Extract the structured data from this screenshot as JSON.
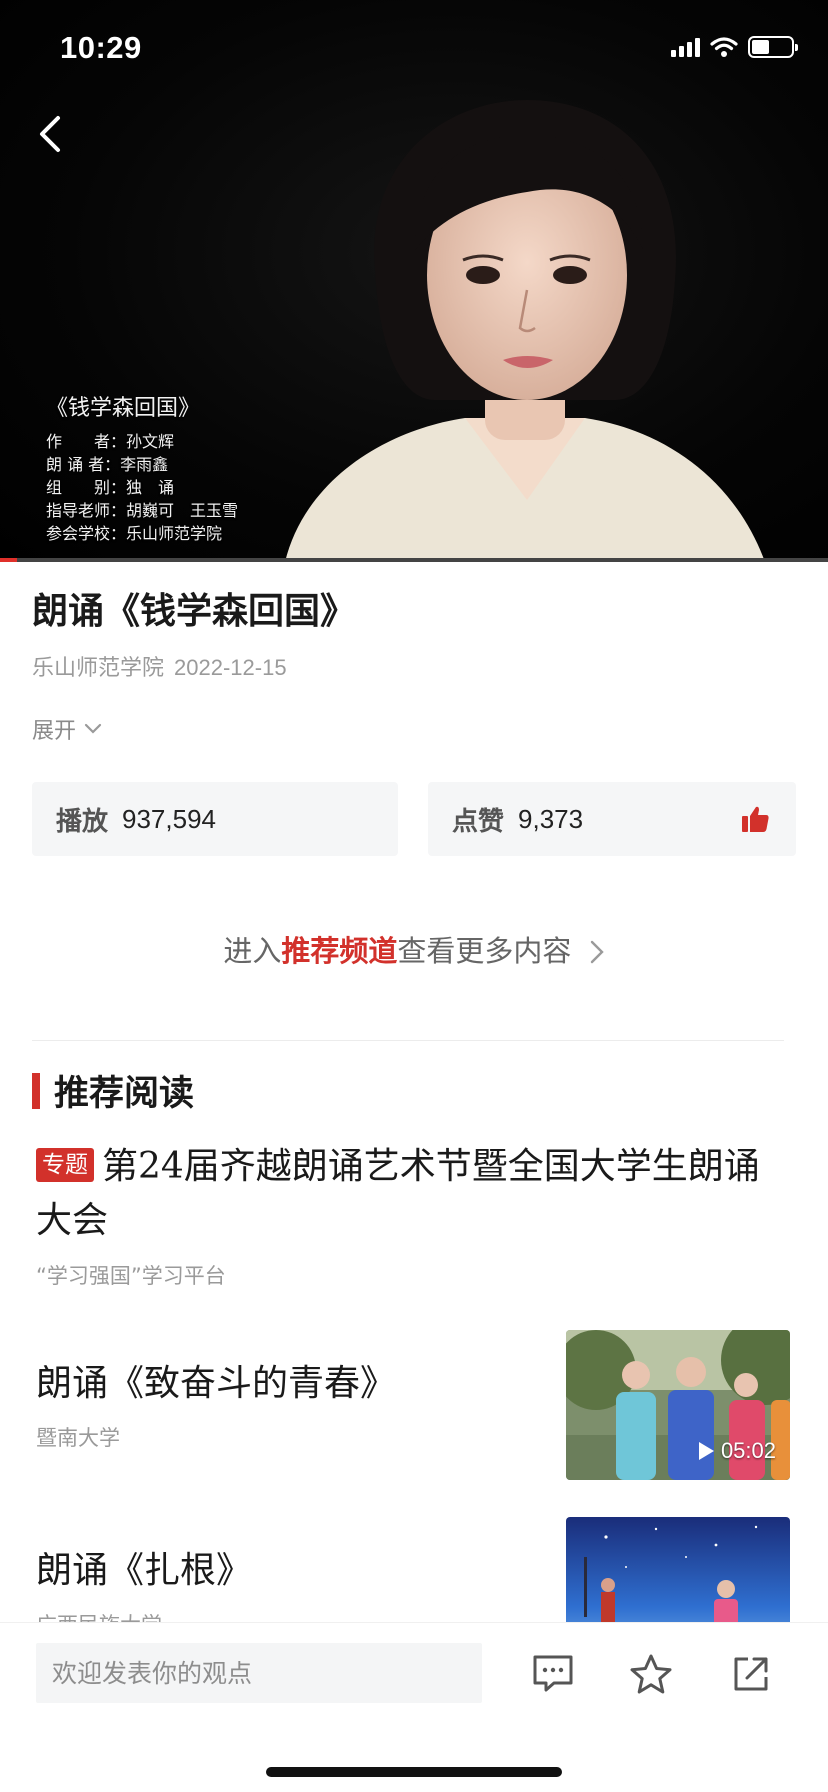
{
  "status_bar": {
    "time": "10:29"
  },
  "video": {
    "credits": {
      "title": "《钱学森回国》",
      "lines": [
        "作　　者：孙文辉",
        "朗 诵 者：李雨鑫",
        "组　　别：独　诵",
        "指导老师：胡巍可　王玉雪",
        "参会学校：乐山师范学院"
      ]
    },
    "progress_fraction": 0.02
  },
  "article": {
    "title": "朗诵《钱学森回国》",
    "source": "乐山师范学院",
    "date": "2022-12-15",
    "expand_label": "展开"
  },
  "stats": {
    "play_label": "播放",
    "play_count": "937,594",
    "like_label": "点赞",
    "like_count": "9,373"
  },
  "channel_link": {
    "prefix": "进入",
    "highlight": "推荐频道",
    "suffix": "查看更多内容"
  },
  "recommended": {
    "section_title": "推荐阅读",
    "topic": {
      "badge": "专题",
      "title": "第24届齐越朗诵艺术节暨全国大学生朗诵大会",
      "source": "“学习强国”学习平台"
    },
    "items": [
      {
        "title": "朗诵《致奋斗的青春》",
        "source": "暨南大学",
        "duration": "05:02"
      },
      {
        "title": "朗诵《扎根》",
        "source": "广西民族大学",
        "duration": ""
      }
    ]
  },
  "bottom_bar": {
    "comment_placeholder": "欢迎发表你的观点"
  },
  "colors": {
    "accent": "#d2312b",
    "video_bg": "#000000",
    "card_bg": "#f5f6f7"
  },
  "icons": [
    "back-icon",
    "signal-icon",
    "wifi-icon",
    "battery-icon",
    "chevron-down-icon",
    "thumbs-up-icon",
    "chevron-right-icon",
    "play-icon",
    "comment-icon",
    "star-icon",
    "share-icon"
  ]
}
